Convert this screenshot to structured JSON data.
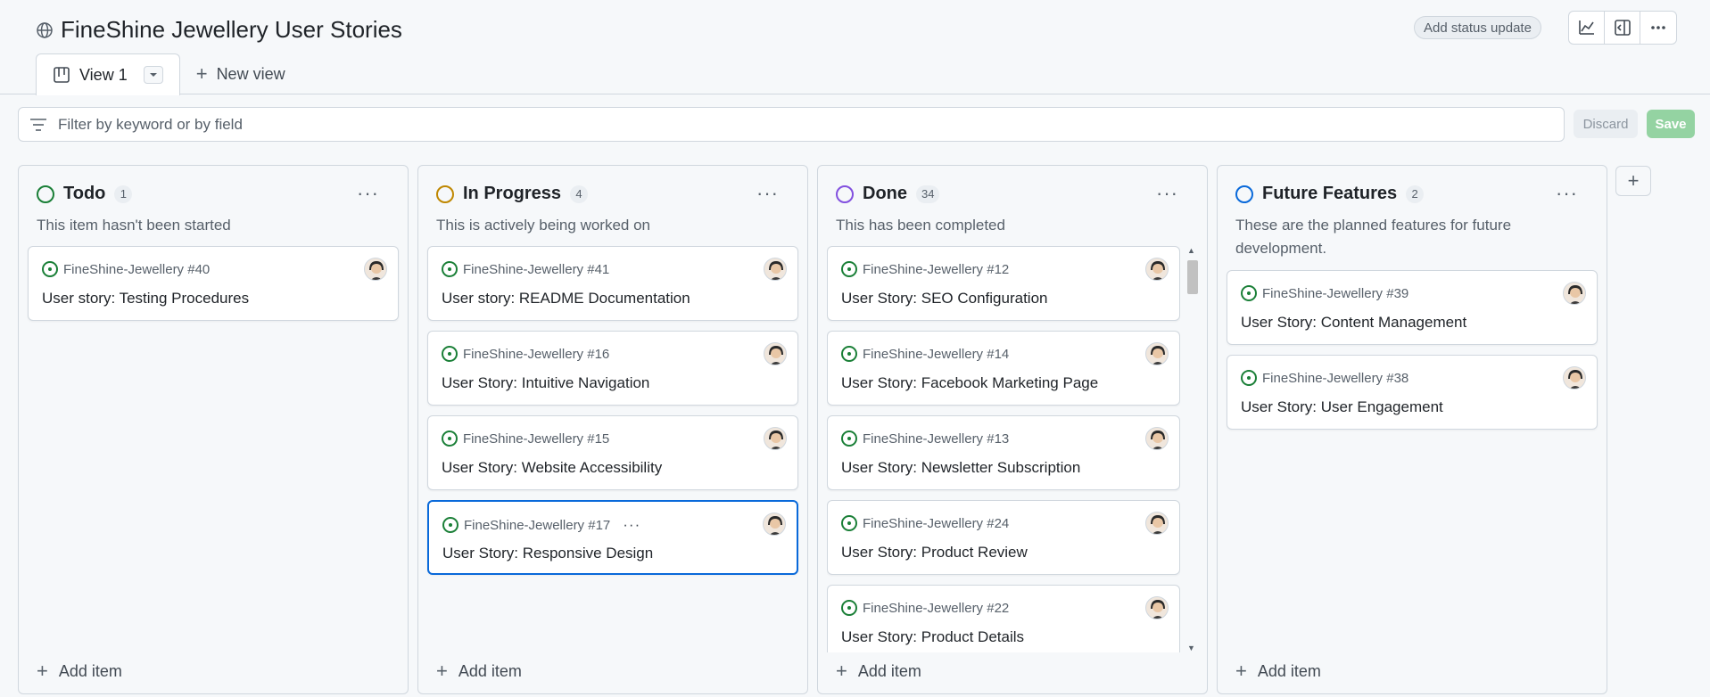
{
  "project": {
    "title": "FineShine Jewellery User Stories"
  },
  "header": {
    "status_update": "Add status update"
  },
  "tabs": {
    "active": "View 1",
    "new_view": "New view"
  },
  "filter": {
    "placeholder": "Filter by keyword or by field",
    "discard": "Discard",
    "save": "Save"
  },
  "colors": {
    "todo": "#1a7f37",
    "in_progress": "#bf8700",
    "done": "#8250df",
    "future": "#0969da",
    "accent": "#0969da"
  },
  "columns": [
    {
      "name": "Todo",
      "count": "1",
      "description": "This item hasn't been started",
      "cards": [
        {
          "repo": "FineShine-Jewellery #40",
          "title": "User story: Testing Procedures"
        }
      ],
      "add_item": "Add item"
    },
    {
      "name": "In Progress",
      "count": "4",
      "description": "This is actively being worked on",
      "cards": [
        {
          "repo": "FineShine-Jewellery #41",
          "title": "User story: README Documentation"
        },
        {
          "repo": "FineShine-Jewellery #16",
          "title": "User Story: Intuitive Navigation"
        },
        {
          "repo": "FineShine-Jewellery #15",
          "title": "User Story: Website Accessibility"
        },
        {
          "repo": "FineShine-Jewellery #17",
          "title": "User Story: Responsive Design"
        }
      ],
      "add_item": "Add item"
    },
    {
      "name": "Done",
      "count": "34",
      "description": "This has been completed",
      "cards": [
        {
          "repo": "FineShine-Jewellery #12",
          "title": "User Story: SEO Configuration"
        },
        {
          "repo": "FineShine-Jewellery #14",
          "title": "User Story: Facebook Marketing Page"
        },
        {
          "repo": "FineShine-Jewellery #13",
          "title": "User Story: Newsletter Subscription"
        },
        {
          "repo": "FineShine-Jewellery #24",
          "title": "User Story: Product Review"
        },
        {
          "repo": "FineShine-Jewellery #22",
          "title": "User Story: Product Details"
        }
      ],
      "add_item": "Add item"
    },
    {
      "name": "Future Features",
      "count": "2",
      "description": "These are the planned features for future development.",
      "cards": [
        {
          "repo": "FineShine-Jewellery #39",
          "title": "User Story: Content Management"
        },
        {
          "repo": "FineShine-Jewellery #38",
          "title": "User Story: User Engagement"
        }
      ],
      "add_item": "Add item"
    }
  ]
}
